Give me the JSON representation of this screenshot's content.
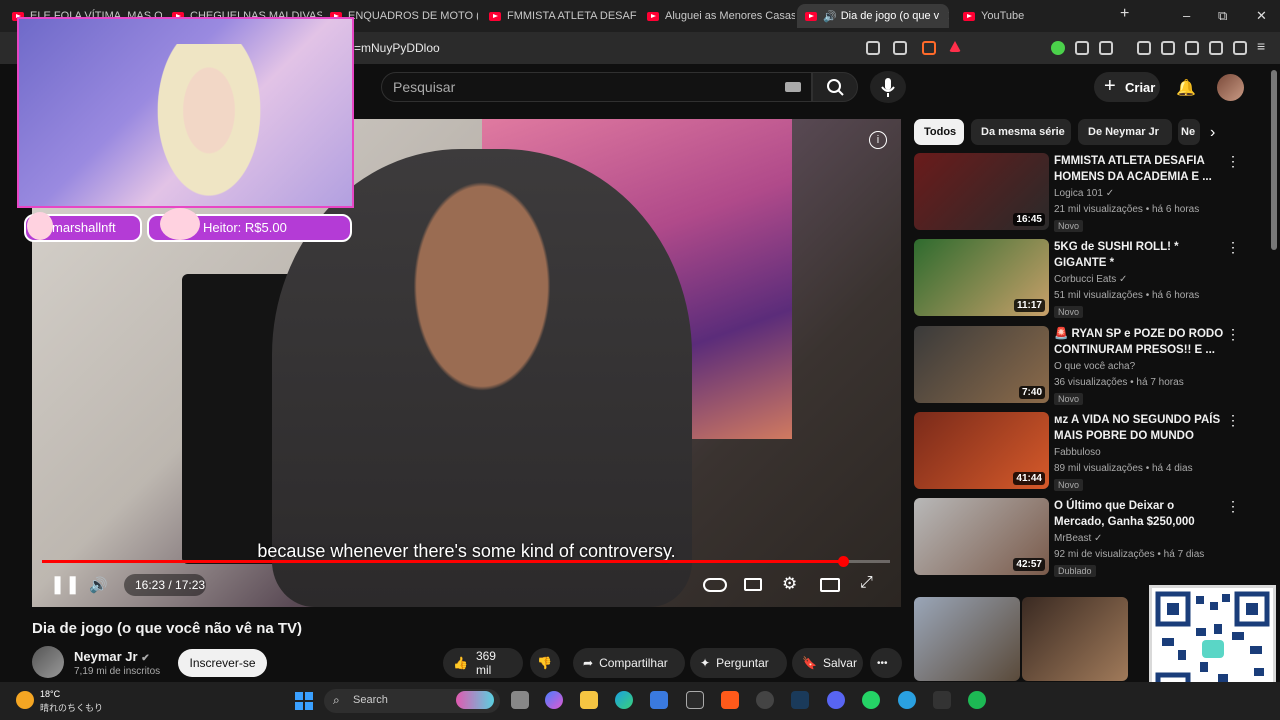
{
  "browser": {
    "tabs": [
      {
        "label": "ELE FOI A VÍTIMA, MAS O"
      },
      {
        "label": "CHEGUEI NAS MALDIVAS E"
      },
      {
        "label": "ENQUADROS DE MOTO (EP"
      },
      {
        "label": "FMMISTA ATLETA DESAFIA"
      },
      {
        "label": "Aluguei as Menores Casas d"
      },
      {
        "label": "Dia de jogo (o que v"
      },
      {
        "label": "YouTube"
      }
    ],
    "new_tab": "+",
    "url": "=mNuyPyDDloo",
    "window_controls": {
      "minimize": "–",
      "maximize": "⧉",
      "close": "✕"
    }
  },
  "youtube": {
    "search_placeholder": "Pesquisar",
    "create_label": "Criar",
    "create_plus": "+",
    "video": {
      "title": "Dia de jogo (o que você não vê na TV)",
      "subtitle_text": "because whenever there's some kind of controversy.",
      "time": "16:23 / 17:23",
      "progress": 0.945,
      "channel": "Neymar Jr",
      "subscribers": "7,19 mi de inscritos",
      "subscribe_label": "Inscrever-se",
      "likes": "369 mil",
      "share_label": "Compartilhar",
      "ask_label": "Perguntar",
      "save_label": "Salvar",
      "more": "•••",
      "info": "i"
    },
    "chips": [
      {
        "label": "Todos",
        "active": true
      },
      {
        "label": "Da mesma série"
      },
      {
        "label": "De Neymar Jr"
      },
      {
        "label": "Ne"
      }
    ],
    "recommendations": [
      {
        "title": "FMMISTA ATLETA DESAFIA HOMENS DA ACADEMIA E ...",
        "channel": "Logica 101 ✓",
        "meta": "21 mil visualizações • há 6 horas",
        "duration": "16:45",
        "badge": "Novo",
        "colors": [
          "#6a1b1b",
          "#2a2a2a"
        ]
      },
      {
        "title": "5KG de SUSHI ROLL! * GIGANTE *",
        "channel": "Corbucci Eats ✓",
        "meta": "51 mil visualizações • há 6 horas",
        "duration": "11:17",
        "badge": "Novo",
        "colors": [
          "#2e6b2e",
          "#c8a06a"
        ]
      },
      {
        "title": "🚨 RYAN SP e POZE DO RODO CONTINURAM PRESOS!! E ...",
        "channel": "O que você acha?",
        "meta": "36 visualizações • há 7 horas",
        "duration": "7:40",
        "badge": "Novo",
        "colors": [
          "#3a3a3a",
          "#8c6b4a"
        ]
      },
      {
        "title": "ᴍᴢ A VIDA NO SEGUNDO PAÍS MAIS POBRE DO MUNDO",
        "channel": "Fabbuloso",
        "meta": "89 mil visualizações • há 4 dias",
        "duration": "41:44",
        "badge": "Novo",
        "colors": [
          "#7a2a1a",
          "#d65a2a"
        ]
      },
      {
        "title": "O Último que Deixar o Mercado, Ganha $250,000",
        "channel": "MrBeast ✓",
        "meta": "92 mi de visualizações • há 7 dias",
        "duration": "42:57",
        "badge": "Dublado",
        "colors": [
          "#b8b8b8",
          "#7a5a4a"
        ]
      }
    ]
  },
  "overlay": {
    "alert_name": "marshallnft",
    "donation": "Heitor: R$5.00"
  },
  "taskbar": {
    "weather_temp": "18°C",
    "weather_desc": "晴れのちくもり",
    "search": "Search"
  },
  "colors": {
    "accent_red": "#ff0000",
    "overlay_purple": "#b43bd6",
    "webcam_border": "#e846c5"
  }
}
